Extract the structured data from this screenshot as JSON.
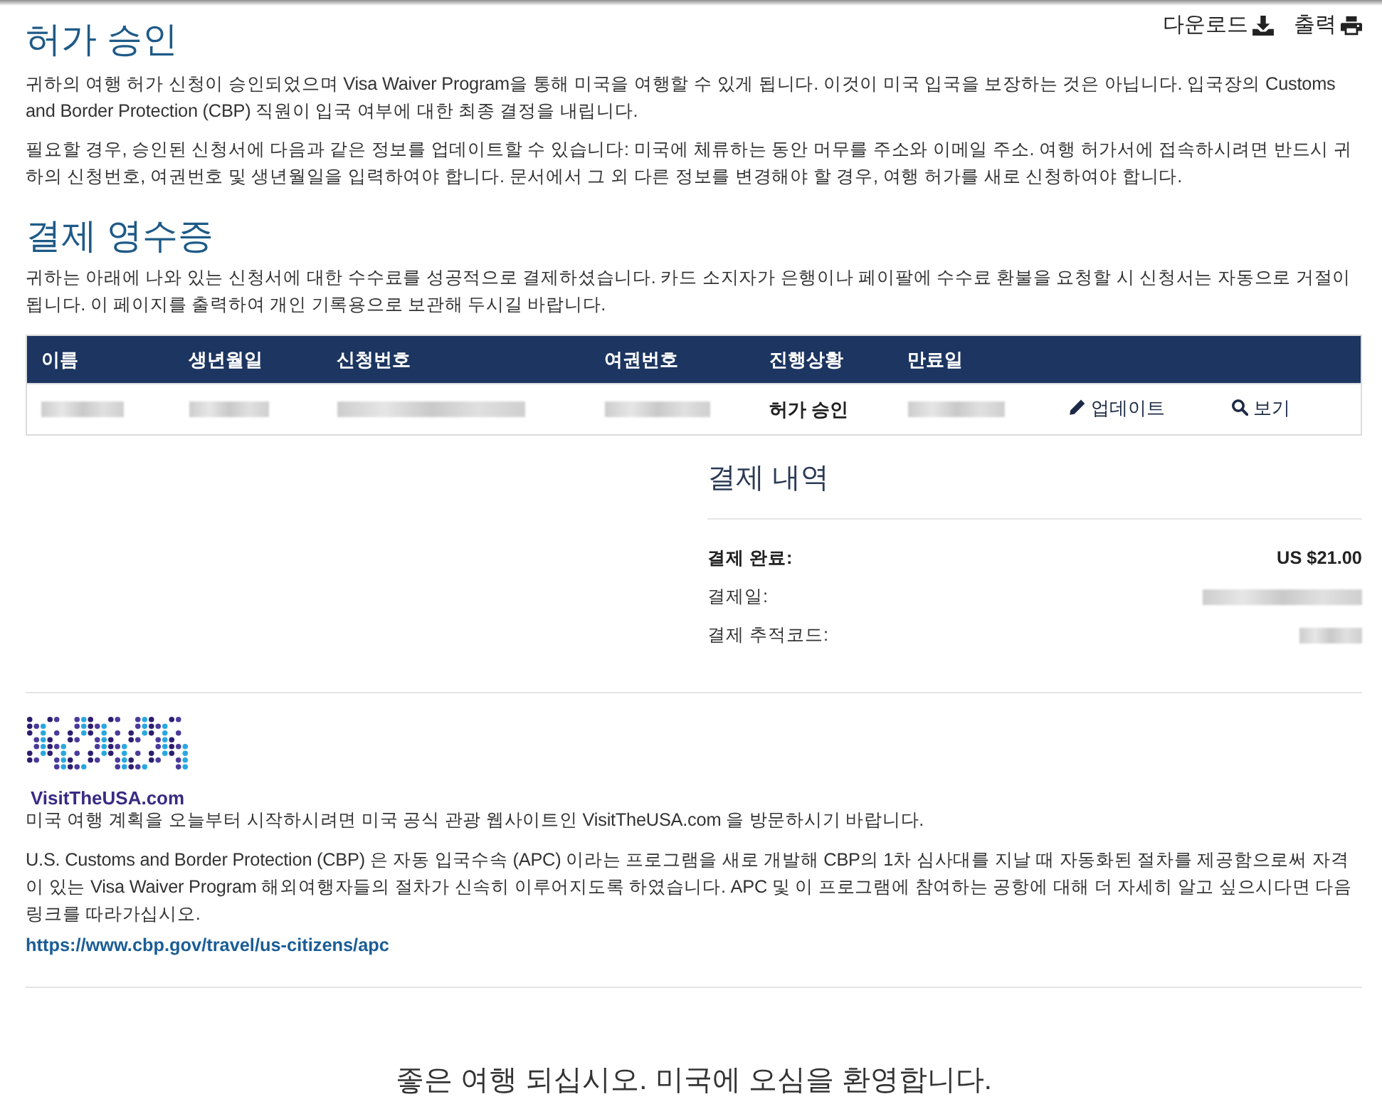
{
  "header_links": [
    {
      "kind": "download",
      "label": "다운로드"
    },
    {
      "kind": "print",
      "label": "출력"
    }
  ],
  "approval": {
    "title": "허가 승인",
    "paragraphs": [
      "귀하의 여행 허가 신청이 승인되었으며 Visa Waiver Program을 통해 미국을 여행할 수 있게 됩니다. 이것이 미국 입국을 보장하는 것은 아닙니다. 입국장의 Customs and Border Protection (CBP) 직원이 입국 여부에 대한 최종 결정을 내립니다.",
      "필요할 경우, 승인된 신청서에 다음과 같은 정보를 업데이트할 수 있습니다: 미국에 체류하는 동안 머무를 주소와 이메일 주소. 여행 허가서에 접속하시려면 반드시 귀하의 신청번호, 여권번호 및 생년월일을 입력하여야 합니다. 문서에서 그 외 다른 정보를 변경해야 할 경우, 여행 허가를 새로 신청하여야 합니다."
    ]
  },
  "receipt": {
    "title": "결제 영수증",
    "paragraph": "귀하는 아래에 나와 있는 신청서에 대한 수수료를 성공적으로 결제하셨습니다. 카드 소지자가 은행이나 페이팔에 수수료 환불을 요청할 시 신청서는 자동으로 거절이 됩니다. 이 페이지를 출력하여 개인 기록용으로 보관해 두시길 바랍니다."
  },
  "table": {
    "columns": [
      "이름",
      "생년월일",
      "신청번호",
      "여권번호",
      "진행상황",
      "만료일"
    ],
    "rows": [
      {
        "cells": [
          {
            "kind": "redacted"
          },
          {
            "kind": "redacted"
          },
          {
            "kind": "redacted"
          },
          {
            "kind": "redacted"
          },
          {
            "kind": "text",
            "text": "허가 승인"
          },
          {
            "kind": "redacted"
          }
        ],
        "actions": [
          {
            "kind": "update",
            "label": "업데이트"
          },
          {
            "kind": "view",
            "label": "보기"
          }
        ]
      }
    ]
  },
  "payment": {
    "title": "결제 내역",
    "rows": [
      {
        "kind": "total",
        "label": "결제 완료:",
        "value": {
          "kind": "text",
          "text": "US $21.00"
        }
      },
      {
        "kind": "detail",
        "label": "결제일:",
        "value": {
          "kind": "redacted"
        }
      },
      {
        "kind": "detail",
        "label": "결제 추적코드:",
        "value": {
          "kind": "redacted"
        }
      }
    ]
  },
  "footer": {
    "logo_text": "VisitTheUSA.com",
    "intro": "미국 여행 계획을 오늘부터 시작하시려면 미국 공식 관광 웹사이트인 VisitTheUSA.com 을 방문하시기 바랍니다.",
    "apc_paragraph": "U.S. Customs and Border Protection (CBP) 은 자동 입국수속 (APC) 이라는 프로그램을 새로 개발해 CBP의 1차 심사대를 지날 때 자동화된 절차를 제공함으로써 자격이 있는 Visa Waiver Program 해외여행자들의 절차가 신속히 이루어지도록 하였습니다. APC 및 이 프로그램에 참여하는 공항에 대해 더 자세히 알고 싶으시다면 다음 링크를 따라가십시오.",
    "link": "https://www.cbp.gov/travel/us-citizens/apc"
  },
  "closing": "좋은 여행 되십시오. 미국에 오심을 환영합니다."
}
